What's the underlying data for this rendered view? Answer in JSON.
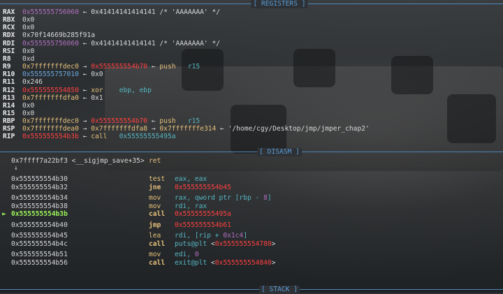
{
  "headers": {
    "registers": "[ REGISTERS ]",
    "disasm": "[ DISASM ]",
    "stack": "[ STACK ]"
  },
  "registers": [
    {
      "name": "RAX",
      "parts": [
        {
          "t": "0x555555756060",
          "c": "m"
        },
        {
          "t": " ← 0x41414141414141 /* 'AAAAAAA' */",
          "c": "grey"
        }
      ]
    },
    {
      "name": "RBX",
      "parts": [
        {
          "t": "0x0",
          "c": "grey"
        }
      ]
    },
    {
      "name": "RCX",
      "parts": [
        {
          "t": "0x0",
          "c": "grey"
        }
      ]
    },
    {
      "name": "RDX",
      "parts": [
        {
          "t": "0x70f14669b285f91a",
          "c": "grey"
        }
      ]
    },
    {
      "name": "RDI",
      "parts": [
        {
          "t": "0x555555756060",
          "c": "m"
        },
        {
          "t": " ← 0x41414141414141 /* 'AAAAAAA' */",
          "c": "grey"
        }
      ]
    },
    {
      "name": "RSI",
      "parts": [
        {
          "t": "0x0",
          "c": "grey"
        }
      ]
    },
    {
      "name": "R8",
      "parts": [
        {
          "t": "0xd",
          "c": "grey"
        }
      ]
    },
    {
      "name": "R9",
      "parts": [
        {
          "t": "0x7fffffffdec0",
          "c": "y"
        },
        {
          "t": " → ",
          "c": "grey"
        },
        {
          "t": "0x555555554b70",
          "c": "r"
        },
        {
          "t": " ← ",
          "c": "grey"
        },
        {
          "t": "push   ",
          "c": "y"
        },
        {
          "t": "r15",
          "c": "c"
        }
      ]
    },
    {
      "name": "R10",
      "parts": [
        {
          "t": "0x555555757010",
          "c": "b"
        },
        {
          "t": " ← 0x0",
          "c": "grey"
        }
      ]
    },
    {
      "name": "R11",
      "parts": [
        {
          "t": "0x246",
          "c": "grey"
        }
      ]
    },
    {
      "name": "R12",
      "parts": [
        {
          "t": "0x555555554850",
          "c": "r"
        },
        {
          "t": " ← ",
          "c": "grey"
        },
        {
          "t": "xor    ",
          "c": "y"
        },
        {
          "t": "ebp, ebp",
          "c": "c"
        }
      ]
    },
    {
      "name": "R13",
      "parts": [
        {
          "t": "0x7fffffffdfa0",
          "c": "y"
        },
        {
          "t": " ← 0x1",
          "c": "grey"
        }
      ]
    },
    {
      "name": "R14",
      "parts": [
        {
          "t": "0x0",
          "c": "grey"
        }
      ]
    },
    {
      "name": "R15",
      "parts": [
        {
          "t": "0x0",
          "c": "grey"
        }
      ]
    },
    {
      "name": "RBP",
      "parts": [
        {
          "t": "0x7fffffffdec0",
          "c": "y"
        },
        {
          "t": " → ",
          "c": "grey"
        },
        {
          "t": "0x555555554b70",
          "c": "r"
        },
        {
          "t": " ← ",
          "c": "grey"
        },
        {
          "t": "push   ",
          "c": "y"
        },
        {
          "t": "r15",
          "c": "c"
        }
      ]
    },
    {
      "name": "RSP",
      "parts": [
        {
          "t": "0x7fffffffdea0",
          "c": "y"
        },
        {
          "t": " → ",
          "c": "grey"
        },
        {
          "t": "0x7fffffffdfa8",
          "c": "y"
        },
        {
          "t": " → ",
          "c": "grey"
        },
        {
          "t": "0x7fffffffe314",
          "c": "y"
        },
        {
          "t": " ← '/home/cgy/Desktop/jmp/jmper_chap2'",
          "c": "grey"
        }
      ]
    },
    {
      "name": "RIP",
      "parts": [
        {
          "t": "0x555555554b3b",
          "c": "r"
        },
        {
          "t": " ← ",
          "c": "grey"
        },
        {
          "t": "call   ",
          "c": "y"
        },
        {
          "t": "0x55555555495a",
          "c": "c"
        }
      ]
    }
  ],
  "disasm": {
    "pre": {
      "addr": "0x7ffff7a22bf3 <__sigjmp_save+35>",
      "mnemonic": "ret"
    },
    "pre_arrow": "↓",
    "current_marker": "►",
    "lines": [
      {
        "addr": "0x555555554b30",
        "mnemonic": "test",
        "operands": [
          {
            "t": "eax, eax",
            "c": "c"
          }
        ],
        "gap_before": true
      },
      {
        "addr": "0x555555554b32",
        "mnemonic": "jne",
        "mn_bold": true,
        "operands": [
          {
            "t": "0x555555554b45",
            "c": "r"
          }
        ]
      },
      {
        "addr": "0x555555554b34",
        "mnemonic": "mov",
        "operands": [
          {
            "t": "rax, qword ptr [rbp - ",
            "c": "c"
          },
          {
            "t": "8",
            "c": "m"
          },
          {
            "t": "]",
            "c": "c"
          }
        ],
        "gap_before": true
      },
      {
        "addr": "0x555555554b38",
        "mnemonic": "mov",
        "operands": [
          {
            "t": "rdi, rax",
            "c": "c"
          }
        ]
      },
      {
        "addr": "0x555555554b3b",
        "mnemonic": "call",
        "mn_bold": true,
        "current": true,
        "operands": [
          {
            "t": "0x55555555495a",
            "c": "r"
          }
        ]
      },
      {
        "addr": "0x555555554b40",
        "mnemonic": "jmp",
        "mn_bold": true,
        "operands": [
          {
            "t": "0x555555554b61",
            "c": "r"
          }
        ],
        "gap_before": true
      },
      {
        "addr": "0x555555554b45",
        "mnemonic": "lea",
        "operands": [
          {
            "t": "rdi, [rip + ",
            "c": "c"
          },
          {
            "t": "0x1c4",
            "c": "m"
          },
          {
            "t": "]",
            "c": "c"
          }
        ],
        "gap_before": true
      },
      {
        "addr": "0x555555554b4c",
        "mnemonic": "call",
        "mn_bold": true,
        "operands": [
          {
            "t": "puts@plt",
            "c": "c"
          },
          {
            "t": " <",
            "c": "grey"
          },
          {
            "t": "0x555555554780",
            "c": "r"
          },
          {
            "t": ">",
            "c": "grey"
          }
        ]
      },
      {
        "addr": "0x555555554b51",
        "mnemonic": "mov",
        "operands": [
          {
            "t": "edi, ",
            "c": "c"
          },
          {
            "t": "0",
            "c": "m"
          }
        ],
        "gap_before": true
      },
      {
        "addr": "0x555555554b56",
        "mnemonic": "call",
        "mn_bold": true,
        "operands": [
          {
            "t": "exit@plt",
            "c": "c"
          },
          {
            "t": " <",
            "c": "grey"
          },
          {
            "t": "0x555555554840",
            "c": "r"
          },
          {
            "t": ">",
            "c": "grey"
          }
        ]
      }
    ]
  },
  "colors": {
    "yellow": "#e5c07b",
    "red": "#ff4040",
    "magenta": "#b06fc0",
    "blue": "#6aa9e0",
    "cyan": "#56b6c2",
    "current": "#9bf55b",
    "separator": "#4b86b8"
  }
}
